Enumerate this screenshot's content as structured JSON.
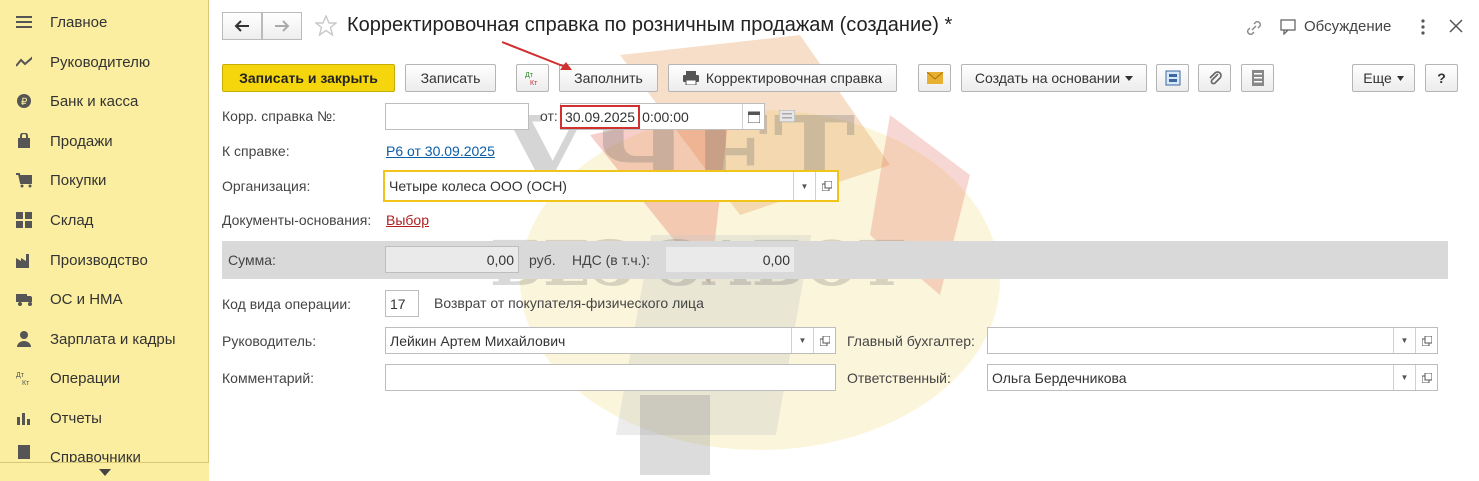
{
  "sidebar": {
    "items": [
      {
        "label": "Главное",
        "icon": "menu-lines-icon"
      },
      {
        "label": "Руководителю",
        "icon": "trend-chart-icon"
      },
      {
        "label": "Банк и касса",
        "icon": "coin-icon"
      },
      {
        "label": "Продажи",
        "icon": "shopping-bag-icon"
      },
      {
        "label": "Покупки",
        "icon": "shopping-cart-icon"
      },
      {
        "label": "Склад",
        "icon": "warehouse-grid-icon"
      },
      {
        "label": "Производство",
        "icon": "factory-icon"
      },
      {
        "label": "ОС и НМА",
        "icon": "truck-icon"
      },
      {
        "label": "Зарплата и кадры",
        "icon": "person-icon"
      },
      {
        "label": "Операции",
        "icon": "dt-kt-icon"
      },
      {
        "label": "Отчеты",
        "icon": "bar-chart-icon"
      },
      {
        "label": "Справочники",
        "icon": "book-icon"
      }
    ]
  },
  "header": {
    "title": "Корректировочная справка по розничным продажам (создание) *",
    "discussion_label": "Обсуждение"
  },
  "toolbar": {
    "save_close": "Записать и закрыть",
    "save": "Записать",
    "dtkt_label": "Дт Кт",
    "fill": "Заполнить",
    "print_label": "Корректировочная справка",
    "create_based": "Создать на основании",
    "more": "Еще",
    "help": "?"
  },
  "form": {
    "number_label": "Корр. справка №:",
    "number_value": "",
    "from_label": "от:",
    "date_value": "30.09.2025",
    "time_value": "0:00:00",
    "ref_label": "К справке:",
    "ref_link": "Р6 от 30.09.2025",
    "org_label": "Организация:",
    "org_value": "Четыре колеса ООО (ОСН)",
    "basis_label": "Документы-основания:",
    "basis_link": "Выбор",
    "sum_label": "Сумма:",
    "sum_value": "0,00",
    "currency": "руб.",
    "vat_label": "НДС (в т.ч.):",
    "vat_value": "0,00",
    "op_code_label": "Код вида операции:",
    "op_code_value": "17",
    "op_code_desc": "Возврат от покупателя-физического лица",
    "head_label": "Руководитель:",
    "head_value": "Лейкин Артем Михайлович",
    "chief_acc_label": "Главный бухгалтер:",
    "chief_acc_value": "",
    "comment_label": "Комментарий:",
    "comment_value": "",
    "responsible_label": "Ответственный:",
    "responsible_value": "Ольга Бердечникова"
  },
  "watermark": {
    "line1": "УЧЕТ",
    "line2": "БЕЗ ЗАБОТ"
  },
  "colors": {
    "sidebar_bg": "#fbeea0",
    "primary_button": "#f5d60c",
    "highlight_border": "#f0c419",
    "annotation_red": "#d03030",
    "link": "#0b5ea8"
  }
}
